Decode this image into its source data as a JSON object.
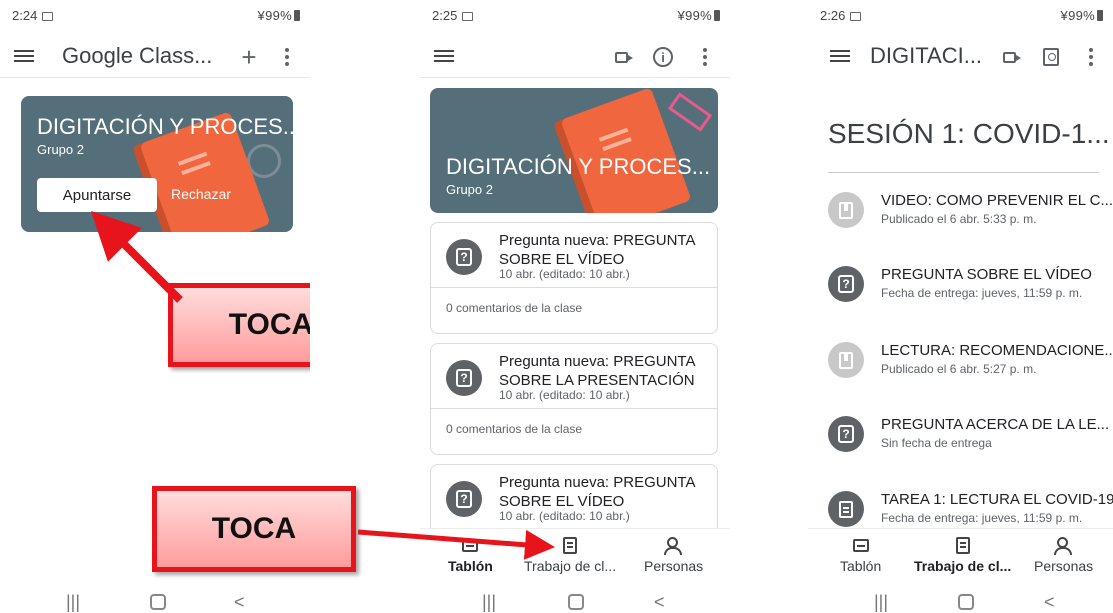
{
  "screen1": {
    "status": {
      "time": "2:24",
      "right": "¥99%"
    },
    "appbar": {
      "title": "Google Class..."
    },
    "card": {
      "title": "DIGITACIÓN Y PROCES...",
      "group": "Grupo 2",
      "join": "Apuntarse",
      "reject": "Rechazar"
    },
    "callout": "TOCA"
  },
  "screen2": {
    "status": {
      "time": "2:25",
      "right": "¥99%"
    },
    "banner": {
      "title": "DIGITACIÓN Y PROCES...",
      "group": "Grupo 2"
    },
    "posts": [
      {
        "title": "Pregunta nueva: PREGUNTA SOBRE EL VÍDEO",
        "date": "10 abr. (editado: 10 abr.)",
        "comments": "0 comentarios de la clase"
      },
      {
        "title": "Pregunta nueva: PREGUNTA SOBRE LA PRESENTACIÓN",
        "date": "10 abr. (editado: 10 abr.)",
        "comments": "0 comentarios de la clase"
      },
      {
        "title": "Pregunta nueva: PREGUNTA SOBRE EL VÍDEO",
        "date": "10 abr. (editado: 10 abr.)"
      }
    ],
    "nav": {
      "stream": "Tablón",
      "classwork": "Trabajo de cl...",
      "people": "Personas"
    },
    "callout": "TOCA"
  },
  "screen3": {
    "status": {
      "time": "2:26",
      "right": "¥99%"
    },
    "appbar": {
      "title": "DIGITACI..."
    },
    "section": "SESIÓN 1: COVID-1...",
    "items": [
      {
        "title": "VIDEO: COMO PREVENIR EL C...",
        "sub": "Publicado el 6 abr. 5:33 p. m."
      },
      {
        "title": "PREGUNTA SOBRE EL VÍDEO",
        "sub": "Fecha de entrega: jueves, 11:59 p. m."
      },
      {
        "title": "LECTURA: RECOMENDACIONE...",
        "sub": "Publicado el 6 abr. 5:27 p. m."
      },
      {
        "title": "PREGUNTA ACERCA DE LA LE...",
        "sub": "Sin fecha de entrega"
      },
      {
        "title": "TAREA 1: LECTURA EL COVID-19",
        "sub": "Fecha de entrega: jueves, 11:59 p. m."
      }
    ],
    "nav": {
      "stream": "Tablón",
      "classwork": "Trabajo de cl...",
      "people": "Personas"
    }
  },
  "colors": {
    "accent_red": "#e8141b",
    "banner": "#546e7a"
  }
}
